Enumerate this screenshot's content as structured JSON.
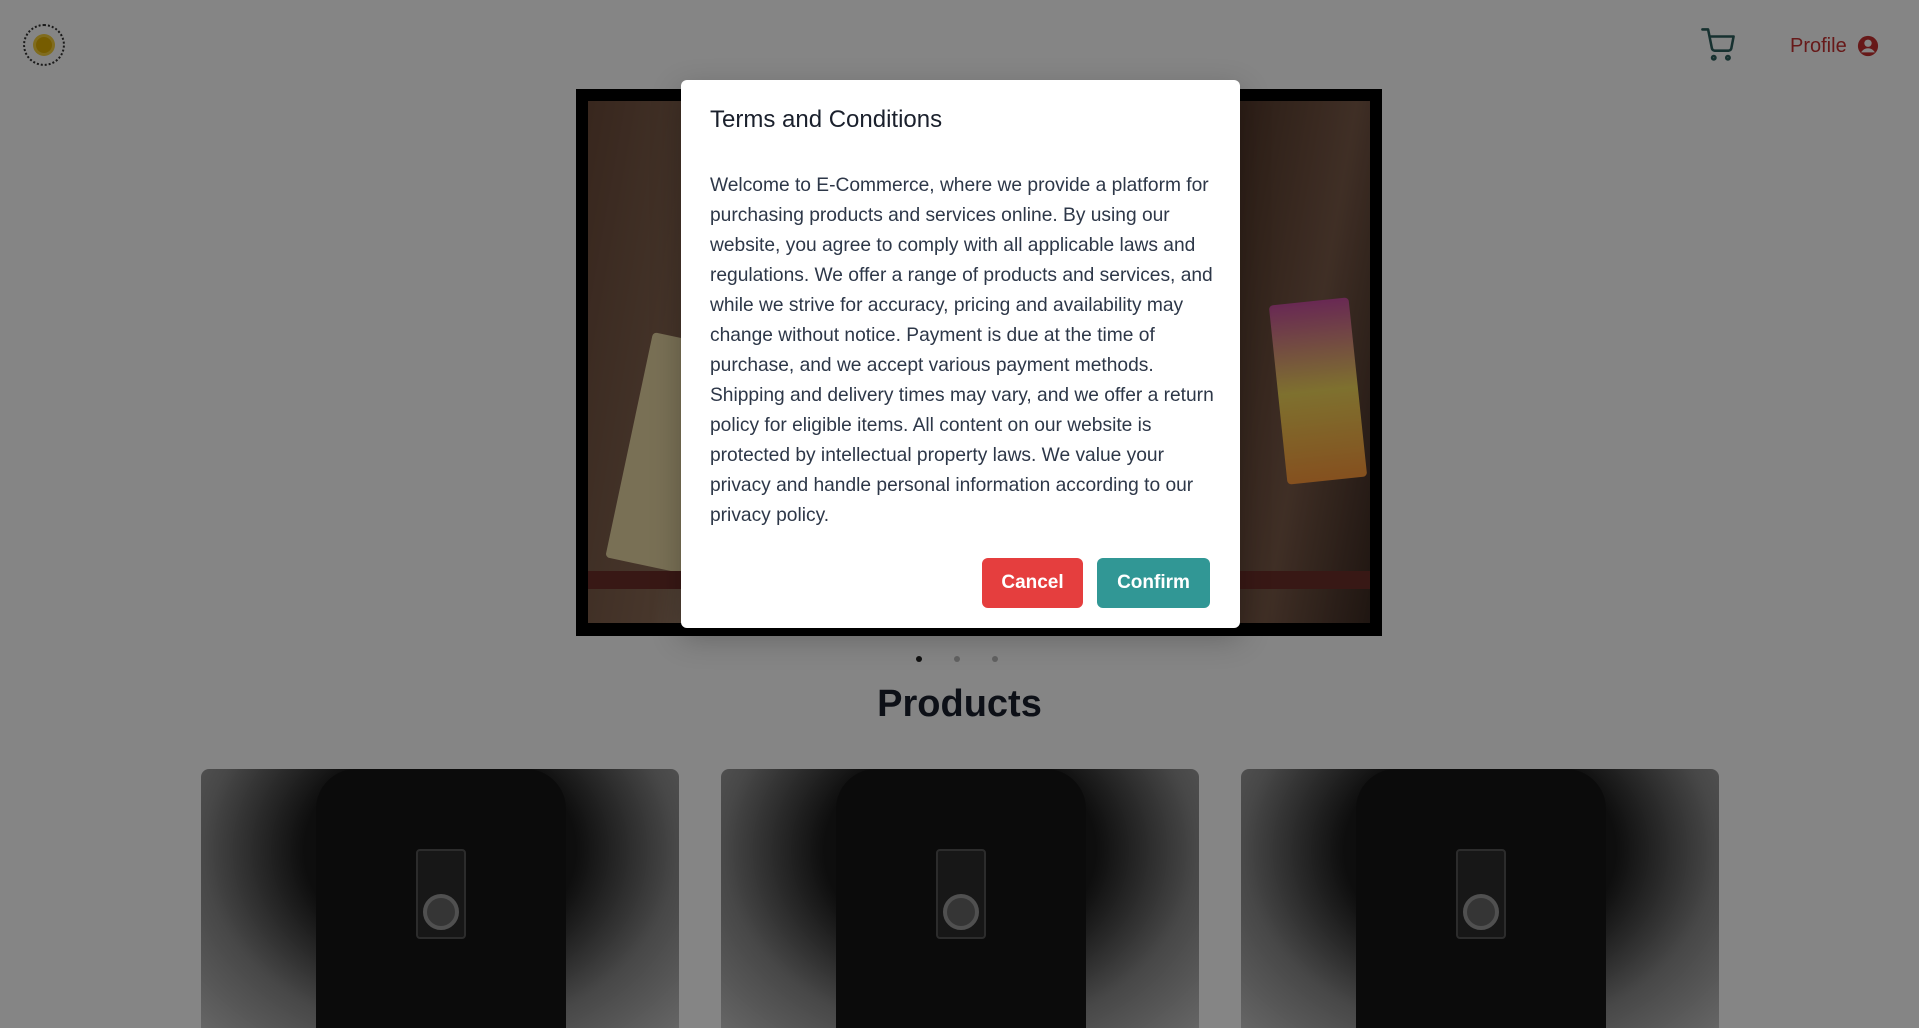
{
  "header": {
    "logo_icon": "ecommerce-sun-logo",
    "cart_icon": "shopping-cart-icon",
    "profile_label": "Profile",
    "profile_icon": "user-circle-icon"
  },
  "carousel": {
    "dots": 3,
    "active_index": 0
  },
  "products": {
    "title": "Products",
    "items": [
      "product-1",
      "product-2",
      "product-3"
    ]
  },
  "modal": {
    "title": "Terms and Conditions",
    "body": "Welcome to E-Commerce, where we provide a platform for purchasing products and services online. By using our website, you agree to comply with all applicable laws and regulations. We offer a range of products and services, and while we strive for accuracy, pricing and availability may change without notice. Payment is due at the time of purchase, and we accept various payment methods. Shipping and delivery times may vary, and we offer a return policy for eligible items. All content on our website is protected by intellectual property laws. We value your privacy and handle personal information according to our privacy policy.",
    "cancel_label": "Cancel",
    "confirm_label": "Confirm"
  },
  "colors": {
    "profile_red": "#c53030",
    "cancel_red": "#e53e3e",
    "confirm_teal": "#319795",
    "cart_teal": "#2c5f5d"
  }
}
